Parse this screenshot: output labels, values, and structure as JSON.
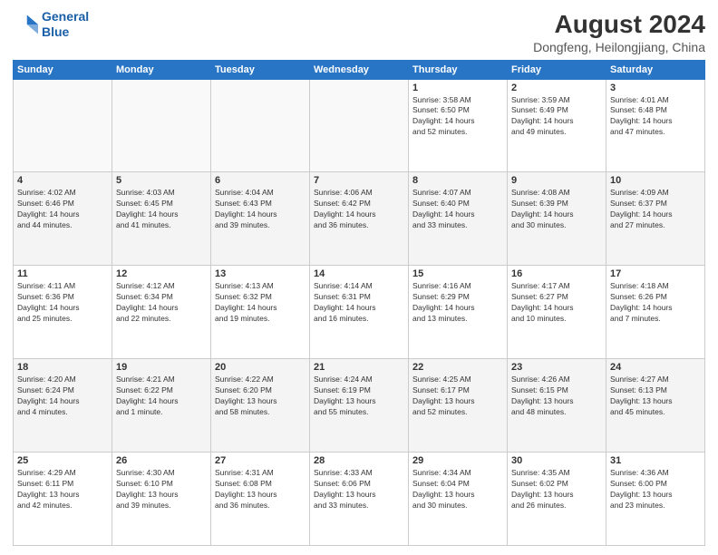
{
  "logo": {
    "line1": "General",
    "line2": "Blue"
  },
  "title": "August 2024",
  "subtitle": "Dongfeng, Heilongjiang, China",
  "days_of_week": [
    "Sunday",
    "Monday",
    "Tuesday",
    "Wednesday",
    "Thursday",
    "Friday",
    "Saturday"
  ],
  "weeks": [
    [
      {
        "day": "",
        "info": ""
      },
      {
        "day": "",
        "info": ""
      },
      {
        "day": "",
        "info": ""
      },
      {
        "day": "",
        "info": ""
      },
      {
        "day": "1",
        "info": "Sunrise: 3:58 AM\nSunset: 6:50 PM\nDaylight: 14 hours\nand 52 minutes."
      },
      {
        "day": "2",
        "info": "Sunrise: 3:59 AM\nSunset: 6:49 PM\nDaylight: 14 hours\nand 49 minutes."
      },
      {
        "day": "3",
        "info": "Sunrise: 4:01 AM\nSunset: 6:48 PM\nDaylight: 14 hours\nand 47 minutes."
      }
    ],
    [
      {
        "day": "4",
        "info": "Sunrise: 4:02 AM\nSunset: 6:46 PM\nDaylight: 14 hours\nand 44 minutes."
      },
      {
        "day": "5",
        "info": "Sunrise: 4:03 AM\nSunset: 6:45 PM\nDaylight: 14 hours\nand 41 minutes."
      },
      {
        "day": "6",
        "info": "Sunrise: 4:04 AM\nSunset: 6:43 PM\nDaylight: 14 hours\nand 39 minutes."
      },
      {
        "day": "7",
        "info": "Sunrise: 4:06 AM\nSunset: 6:42 PM\nDaylight: 14 hours\nand 36 minutes."
      },
      {
        "day": "8",
        "info": "Sunrise: 4:07 AM\nSunset: 6:40 PM\nDaylight: 14 hours\nand 33 minutes."
      },
      {
        "day": "9",
        "info": "Sunrise: 4:08 AM\nSunset: 6:39 PM\nDaylight: 14 hours\nand 30 minutes."
      },
      {
        "day": "10",
        "info": "Sunrise: 4:09 AM\nSunset: 6:37 PM\nDaylight: 14 hours\nand 27 minutes."
      }
    ],
    [
      {
        "day": "11",
        "info": "Sunrise: 4:11 AM\nSunset: 6:36 PM\nDaylight: 14 hours\nand 25 minutes."
      },
      {
        "day": "12",
        "info": "Sunrise: 4:12 AM\nSunset: 6:34 PM\nDaylight: 14 hours\nand 22 minutes."
      },
      {
        "day": "13",
        "info": "Sunrise: 4:13 AM\nSunset: 6:32 PM\nDaylight: 14 hours\nand 19 minutes."
      },
      {
        "day": "14",
        "info": "Sunrise: 4:14 AM\nSunset: 6:31 PM\nDaylight: 14 hours\nand 16 minutes."
      },
      {
        "day": "15",
        "info": "Sunrise: 4:16 AM\nSunset: 6:29 PM\nDaylight: 14 hours\nand 13 minutes."
      },
      {
        "day": "16",
        "info": "Sunrise: 4:17 AM\nSunset: 6:27 PM\nDaylight: 14 hours\nand 10 minutes."
      },
      {
        "day": "17",
        "info": "Sunrise: 4:18 AM\nSunset: 6:26 PM\nDaylight: 14 hours\nand 7 minutes."
      }
    ],
    [
      {
        "day": "18",
        "info": "Sunrise: 4:20 AM\nSunset: 6:24 PM\nDaylight: 14 hours\nand 4 minutes."
      },
      {
        "day": "19",
        "info": "Sunrise: 4:21 AM\nSunset: 6:22 PM\nDaylight: 14 hours\nand 1 minute."
      },
      {
        "day": "20",
        "info": "Sunrise: 4:22 AM\nSunset: 6:20 PM\nDaylight: 13 hours\nand 58 minutes."
      },
      {
        "day": "21",
        "info": "Sunrise: 4:24 AM\nSunset: 6:19 PM\nDaylight: 13 hours\nand 55 minutes."
      },
      {
        "day": "22",
        "info": "Sunrise: 4:25 AM\nSunset: 6:17 PM\nDaylight: 13 hours\nand 52 minutes."
      },
      {
        "day": "23",
        "info": "Sunrise: 4:26 AM\nSunset: 6:15 PM\nDaylight: 13 hours\nand 48 minutes."
      },
      {
        "day": "24",
        "info": "Sunrise: 4:27 AM\nSunset: 6:13 PM\nDaylight: 13 hours\nand 45 minutes."
      }
    ],
    [
      {
        "day": "25",
        "info": "Sunrise: 4:29 AM\nSunset: 6:11 PM\nDaylight: 13 hours\nand 42 minutes."
      },
      {
        "day": "26",
        "info": "Sunrise: 4:30 AM\nSunset: 6:10 PM\nDaylight: 13 hours\nand 39 minutes."
      },
      {
        "day": "27",
        "info": "Sunrise: 4:31 AM\nSunset: 6:08 PM\nDaylight: 13 hours\nand 36 minutes."
      },
      {
        "day": "28",
        "info": "Sunrise: 4:33 AM\nSunset: 6:06 PM\nDaylight: 13 hours\nand 33 minutes."
      },
      {
        "day": "29",
        "info": "Sunrise: 4:34 AM\nSunset: 6:04 PM\nDaylight: 13 hours\nand 30 minutes."
      },
      {
        "day": "30",
        "info": "Sunrise: 4:35 AM\nSunset: 6:02 PM\nDaylight: 13 hours\nand 26 minutes."
      },
      {
        "day": "31",
        "info": "Sunrise: 4:36 AM\nSunset: 6:00 PM\nDaylight: 13 hours\nand 23 minutes."
      }
    ]
  ]
}
